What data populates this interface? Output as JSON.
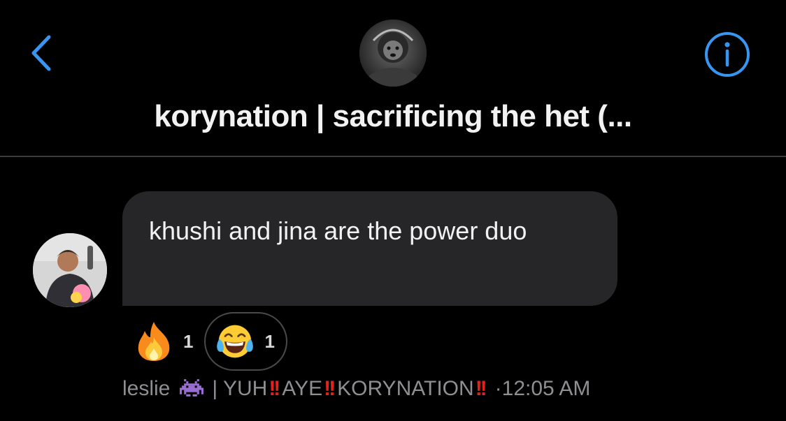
{
  "header": {
    "title": "korynation | sacrificing the het (...",
    "back_icon": "chevron-left-icon",
    "info_icon": "info-icon",
    "accent_color": "#3797f0"
  },
  "message": {
    "text": "khushi and jina are the power duo"
  },
  "reactions": [
    {
      "emoji": "fire",
      "count": "1"
    },
    {
      "emoji": "face-with-tears-of-joy",
      "count": "1"
    }
  ],
  "sender": {
    "name_prefix": "leslie",
    "alien_icon": "alien-monster-icon",
    "part1": "| YUH",
    "part2": "AYE",
    "part3": "KORYNATION",
    "bang": "!!",
    "time": "·12:05 AM"
  }
}
